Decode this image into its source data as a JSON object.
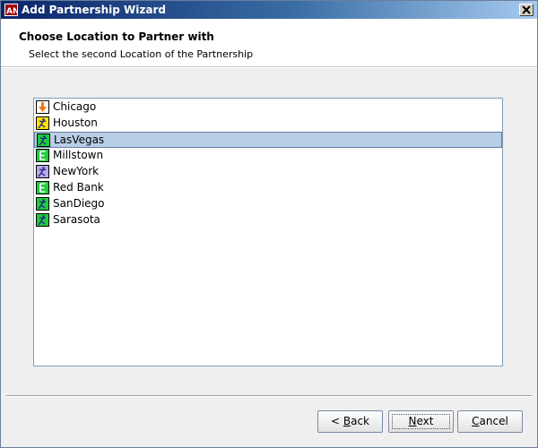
{
  "window": {
    "title": "Add Partnership Wizard",
    "app_icon": "AN",
    "close_icon": "close-icon"
  },
  "header": {
    "title": "Choose Location to Partner with",
    "subtitle": "Select the second Location of the Partnership"
  },
  "locations": [
    {
      "label": "Chicago",
      "icon": "down-arrow-icon",
      "selected": false
    },
    {
      "label": "Houston",
      "icon": "yellow-figure-icon",
      "selected": false
    },
    {
      "label": "LasVegas",
      "icon": "green-figure-icon",
      "selected": true
    },
    {
      "label": "Millstown",
      "icon": "e-icon",
      "selected": false
    },
    {
      "label": "NewYork",
      "icon": "purple-figure-icon",
      "selected": false
    },
    {
      "label": "Red Bank",
      "icon": "e-icon",
      "selected": false
    },
    {
      "label": "SanDiego",
      "icon": "green-figure-icon",
      "selected": false
    },
    {
      "label": "Sarasota",
      "icon": "green-figure-icon",
      "selected": false
    }
  ],
  "buttons": {
    "back": {
      "mnemonic": "",
      "prefix": "< ",
      "underlined": "B",
      "rest": "ack"
    },
    "next": {
      "underlined": "N",
      "rest": "ext"
    },
    "cancel": {
      "underlined": "C",
      "rest": "ancel"
    }
  },
  "colors": {
    "title_bar": "#0a246a",
    "selection": "#b9cfe8",
    "list_border": "#7f9db9"
  }
}
